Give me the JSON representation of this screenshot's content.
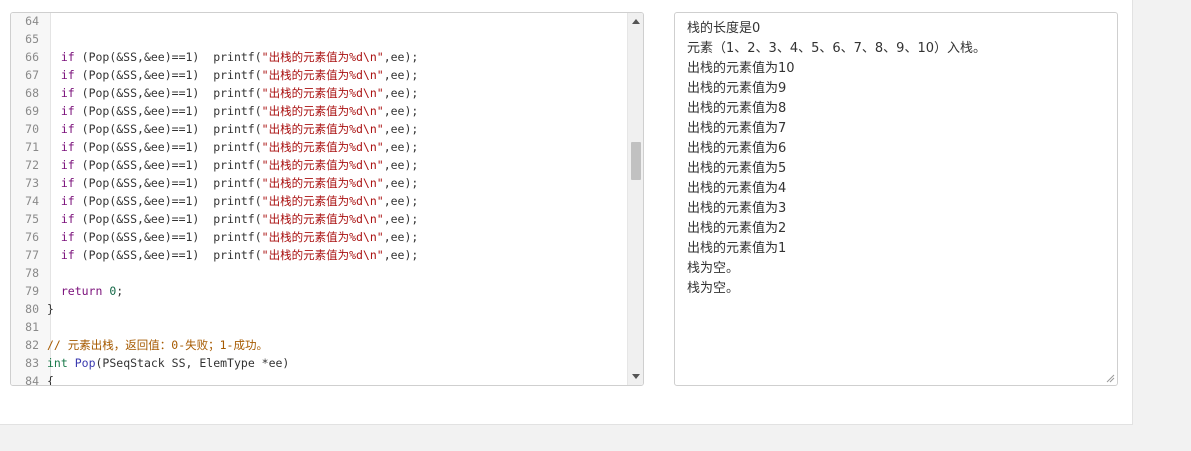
{
  "editor": {
    "lines": [
      {
        "n": "64",
        "tokens": []
      },
      {
        "n": "65",
        "tokens": []
      },
      {
        "n": "66",
        "tokens": [
          {
            "c": "",
            "t": "  "
          },
          {
            "c": "kw",
            "t": "if"
          },
          {
            "c": "",
            "t": " (Pop(&SS,&ee)==1)  printf("
          },
          {
            "c": "str",
            "t": "\"出栈的元素值为%d\\n\""
          },
          {
            "c": "",
            "t": ",ee);"
          }
        ]
      },
      {
        "n": "67",
        "tokens": [
          {
            "c": "",
            "t": "  "
          },
          {
            "c": "kw",
            "t": "if"
          },
          {
            "c": "",
            "t": " (Pop(&SS,&ee)==1)  printf("
          },
          {
            "c": "str",
            "t": "\"出栈的元素值为%d\\n\""
          },
          {
            "c": "",
            "t": ",ee);"
          }
        ]
      },
      {
        "n": "68",
        "tokens": [
          {
            "c": "",
            "t": "  "
          },
          {
            "c": "kw",
            "t": "if"
          },
          {
            "c": "",
            "t": " (Pop(&SS,&ee)==1)  printf("
          },
          {
            "c": "str",
            "t": "\"出栈的元素值为%d\\n\""
          },
          {
            "c": "",
            "t": ",ee);"
          }
        ]
      },
      {
        "n": "69",
        "tokens": [
          {
            "c": "",
            "t": "  "
          },
          {
            "c": "kw",
            "t": "if"
          },
          {
            "c": "",
            "t": " (Pop(&SS,&ee)==1)  printf("
          },
          {
            "c": "str",
            "t": "\"出栈的元素值为%d\\n\""
          },
          {
            "c": "",
            "t": ",ee);"
          }
        ]
      },
      {
        "n": "70",
        "tokens": [
          {
            "c": "",
            "t": "  "
          },
          {
            "c": "kw",
            "t": "if"
          },
          {
            "c": "",
            "t": " (Pop(&SS,&ee)==1)  printf("
          },
          {
            "c": "str",
            "t": "\"出栈的元素值为%d\\n\""
          },
          {
            "c": "",
            "t": ",ee);"
          }
        ]
      },
      {
        "n": "71",
        "tokens": [
          {
            "c": "",
            "t": "  "
          },
          {
            "c": "kw",
            "t": "if"
          },
          {
            "c": "",
            "t": " (Pop(&SS,&ee)==1)  printf("
          },
          {
            "c": "str",
            "t": "\"出栈的元素值为%d\\n\""
          },
          {
            "c": "",
            "t": ",ee);"
          }
        ]
      },
      {
        "n": "72",
        "tokens": [
          {
            "c": "",
            "t": "  "
          },
          {
            "c": "kw",
            "t": "if"
          },
          {
            "c": "",
            "t": " (Pop(&SS,&ee)==1)  printf("
          },
          {
            "c": "str",
            "t": "\"出栈的元素值为%d\\n\""
          },
          {
            "c": "",
            "t": ",ee);"
          }
        ]
      },
      {
        "n": "73",
        "tokens": [
          {
            "c": "",
            "t": "  "
          },
          {
            "c": "kw",
            "t": "if"
          },
          {
            "c": "",
            "t": " (Pop(&SS,&ee)==1)  printf("
          },
          {
            "c": "str",
            "t": "\"出栈的元素值为%d\\n\""
          },
          {
            "c": "",
            "t": ",ee);"
          }
        ]
      },
      {
        "n": "74",
        "tokens": [
          {
            "c": "",
            "t": "  "
          },
          {
            "c": "kw",
            "t": "if"
          },
          {
            "c": "",
            "t": " (Pop(&SS,&ee)==1)  printf("
          },
          {
            "c": "str",
            "t": "\"出栈的元素值为%d\\n\""
          },
          {
            "c": "",
            "t": ",ee);"
          }
        ]
      },
      {
        "n": "75",
        "tokens": [
          {
            "c": "",
            "t": "  "
          },
          {
            "c": "kw",
            "t": "if"
          },
          {
            "c": "",
            "t": " (Pop(&SS,&ee)==1)  printf("
          },
          {
            "c": "str",
            "t": "\"出栈的元素值为%d\\n\""
          },
          {
            "c": "",
            "t": ",ee);"
          }
        ]
      },
      {
        "n": "76",
        "tokens": [
          {
            "c": "",
            "t": "  "
          },
          {
            "c": "kw",
            "t": "if"
          },
          {
            "c": "",
            "t": " (Pop(&SS,&ee)==1)  printf("
          },
          {
            "c": "str",
            "t": "\"出栈的元素值为%d\\n\""
          },
          {
            "c": "",
            "t": ",ee);"
          }
        ]
      },
      {
        "n": "77",
        "tokens": [
          {
            "c": "",
            "t": "  "
          },
          {
            "c": "kw",
            "t": "if"
          },
          {
            "c": "",
            "t": " (Pop(&SS,&ee)==1)  printf("
          },
          {
            "c": "str",
            "t": "\"出栈的元素值为%d\\n\""
          },
          {
            "c": "",
            "t": ",ee);"
          }
        ]
      },
      {
        "n": "78",
        "tokens": []
      },
      {
        "n": "79",
        "tokens": [
          {
            "c": "",
            "t": "  "
          },
          {
            "c": "kw",
            "t": "return"
          },
          {
            "c": "",
            "t": " "
          },
          {
            "c": "num",
            "t": "0"
          },
          {
            "c": "",
            "t": ";"
          }
        ]
      },
      {
        "n": "80",
        "tokens": [
          {
            "c": "",
            "t": "}"
          }
        ]
      },
      {
        "n": "81",
        "tokens": []
      },
      {
        "n": "82",
        "tokens": [
          {
            "c": "cm",
            "t": "// 元素出栈，返回值：0-失败；1-成功。"
          }
        ]
      },
      {
        "n": "83",
        "tokens": [
          {
            "c": "tp",
            "t": "int"
          },
          {
            "c": "",
            "t": " "
          },
          {
            "c": "fn",
            "t": "Pop"
          },
          {
            "c": "",
            "t": "(PSeqStack SS, ElemType *ee)"
          }
        ]
      },
      {
        "n": "84",
        "tokens": [
          {
            "c": "",
            "t": "{"
          }
        ]
      }
    ]
  },
  "output": {
    "lines": [
      "栈的长度是0",
      "元素（1、2、3、4、5、6、7、8、9、10）入栈。",
      "出栈的元素值为10",
      "出栈的元素值为9",
      "出栈的元素值为8",
      "出栈的元素值为7",
      "出栈的元素值为6",
      "出栈的元素值为5",
      "出栈的元素值为4",
      "出栈的元素值为3",
      "出栈的元素值为2",
      "出栈的元素值为1",
      "栈为空。",
      "栈为空。"
    ]
  },
  "icons": {
    "scroll_up": "scroll-up-arrow-icon",
    "scroll_down": "scroll-down-arrow-icon",
    "resize": "resize-grip-icon"
  }
}
